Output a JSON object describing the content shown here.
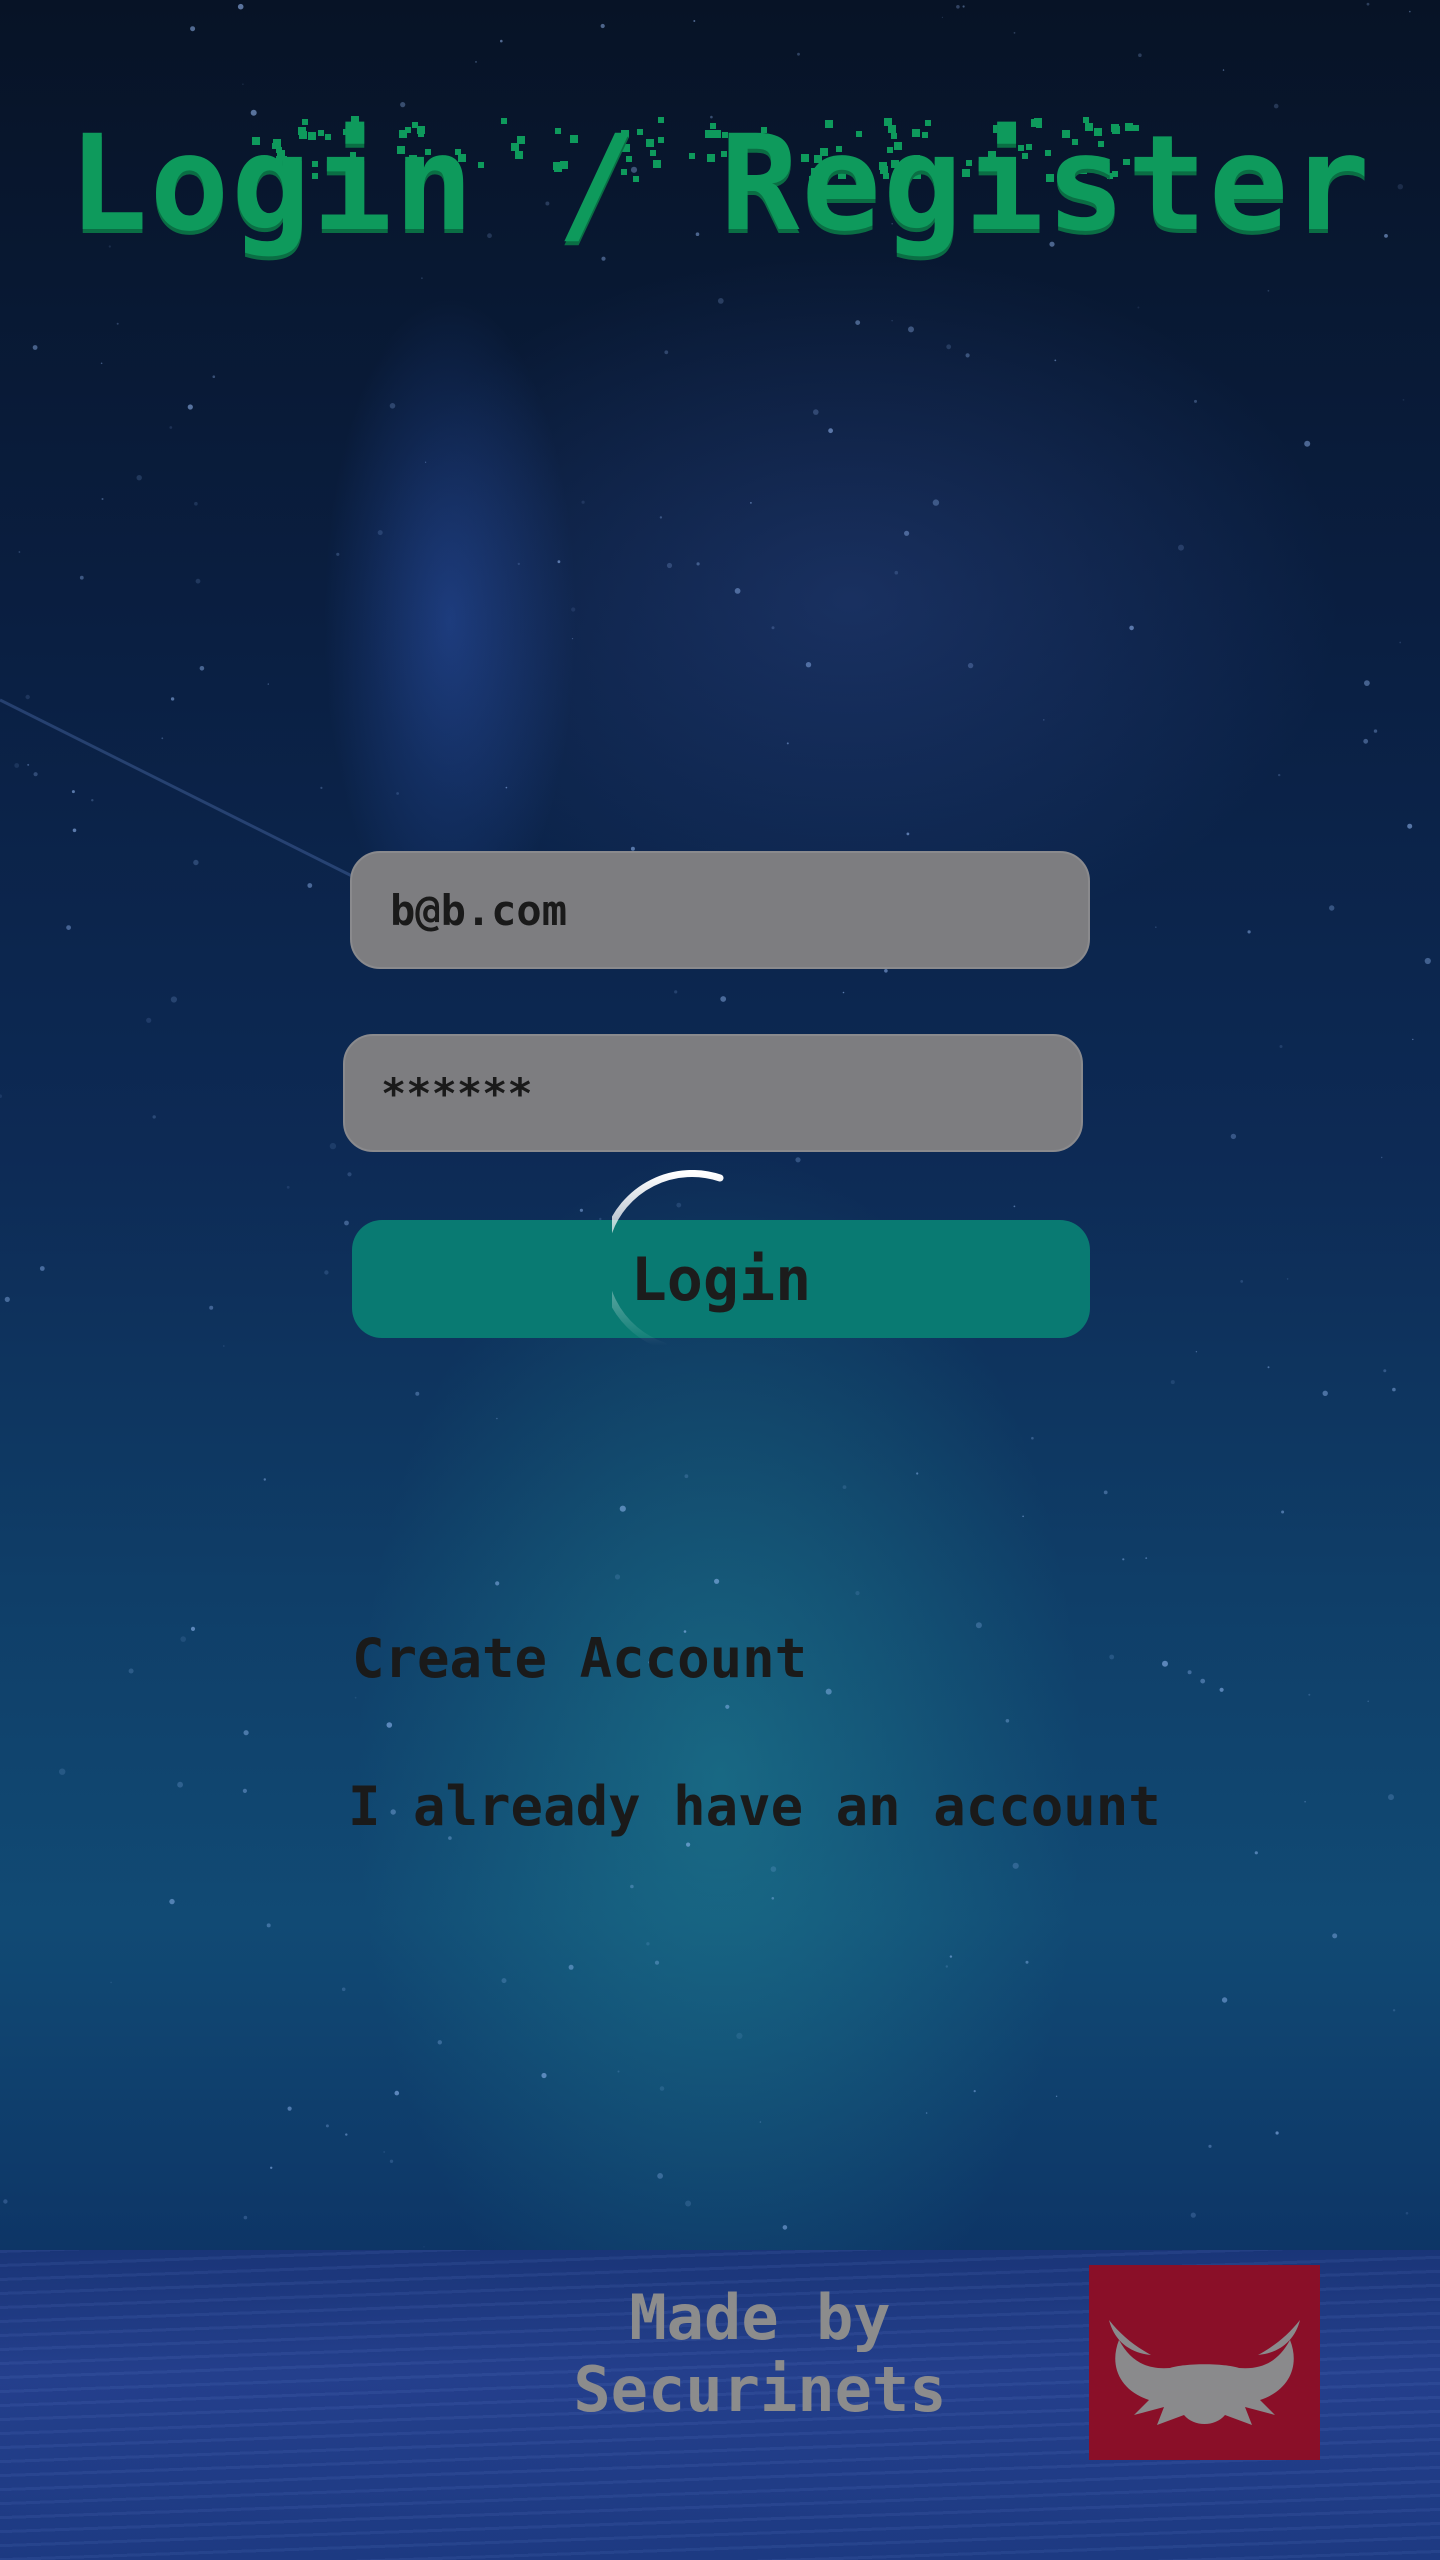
{
  "page": {
    "title": "Login / Register"
  },
  "form": {
    "email_value": "b@b.com",
    "password_value": "******",
    "login_label": "Login",
    "loading": true
  },
  "links": {
    "create_account": "Create Account",
    "have_account": "I already have an account"
  },
  "footer": {
    "made_by_line1": "Made by",
    "made_by_line2": "Securinets",
    "logo_icon": "securinets-logo-icon"
  },
  "colors": {
    "title": "#0e9a5c",
    "field_bg": "#7d7d80",
    "button_bg": "#097a72",
    "logo_bg": "#8a0f28",
    "footer_text": "#8c8c8c"
  }
}
